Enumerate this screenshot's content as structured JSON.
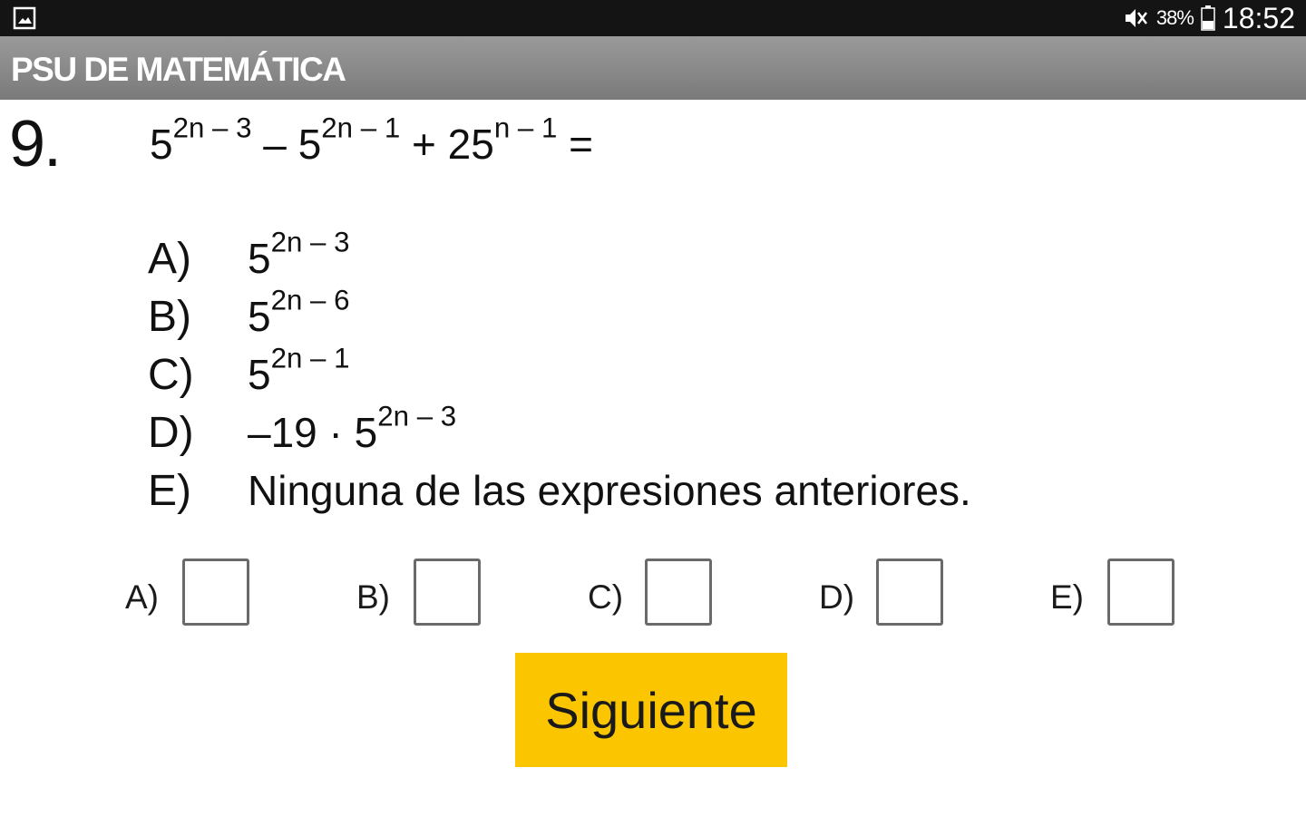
{
  "status_bar": {
    "battery_percent": "38%",
    "time": "18:52",
    "icons": [
      "gallery-icon",
      "mute-icon",
      "battery-icon"
    ]
  },
  "app_bar": {
    "title": "PSU DE MATEMÁTICA"
  },
  "question": {
    "number": "9.",
    "expression": {
      "t1_base": "5",
      "t1_exp": "2n – 3",
      "op1": " – ",
      "t2_base": "5",
      "t2_exp": "2n – 1",
      "op2": " + ",
      "t3_base": "25",
      "t3_exp": "n – 1",
      "eq": " ="
    }
  },
  "options": [
    {
      "letter": "A)",
      "prefix": "",
      "base": "5",
      "exp": "2n – 3",
      "text": ""
    },
    {
      "letter": "B)",
      "prefix": "",
      "base": "5",
      "exp": "2n – 6",
      "text": ""
    },
    {
      "letter": "C)",
      "prefix": "",
      "base": "5",
      "exp": "2n – 1",
      "text": ""
    },
    {
      "letter": "D)",
      "prefix": "–19 · ",
      "base": "5",
      "exp": "2n – 3",
      "text": ""
    },
    {
      "letter": "E)",
      "prefix": "",
      "base": "",
      "exp": "",
      "text": "Ninguna de las expresiones anteriores."
    }
  ],
  "answers": [
    {
      "label": "A)",
      "checked": false
    },
    {
      "label": "B)",
      "checked": false
    },
    {
      "label": "C)",
      "checked": false
    },
    {
      "label": "D)",
      "checked": false
    },
    {
      "label": "E)",
      "checked": false
    }
  ],
  "next_button": {
    "label": "Siguiente",
    "color": "#fbc500"
  }
}
